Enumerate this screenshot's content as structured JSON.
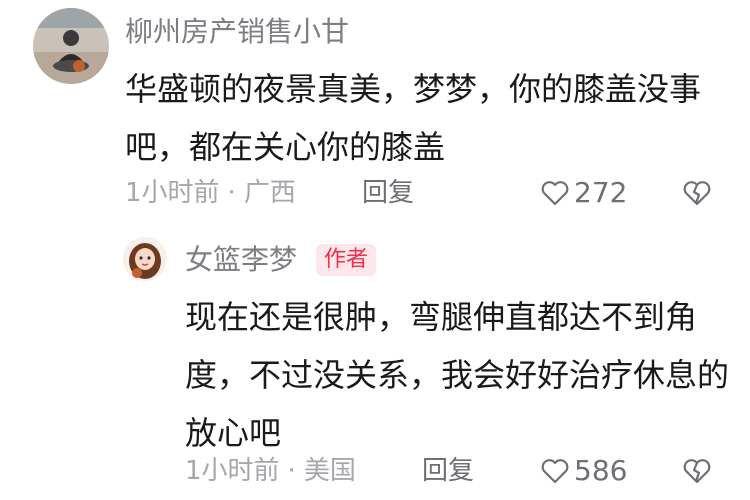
{
  "comment": {
    "author": "柳州房产销售小甘",
    "text": "华盛顿的夜景真美，梦梦，你的膝盖没事吧，都在关心你的膝盖",
    "time": "1小时前",
    "location": "广西",
    "reply_label": "回复",
    "likes": "272",
    "avatar_icon": "person-sitting-on-court-avatar",
    "like_icon": "heart-outline-icon",
    "dislike_icon": "broken-heart-icon"
  },
  "reply": {
    "author": "女篮李梦",
    "badge": "作者",
    "text": "现在还是很肿，弯腿伸直都达不到角度，不过没关系，我会好好治疗休息的  放心吧",
    "time": "1小时前",
    "location": "美国",
    "reply_label": "回复",
    "likes": "586",
    "avatar_icon": "cartoon-girl-avatar",
    "badge_color": "#f0304a"
  },
  "separator": "·"
}
